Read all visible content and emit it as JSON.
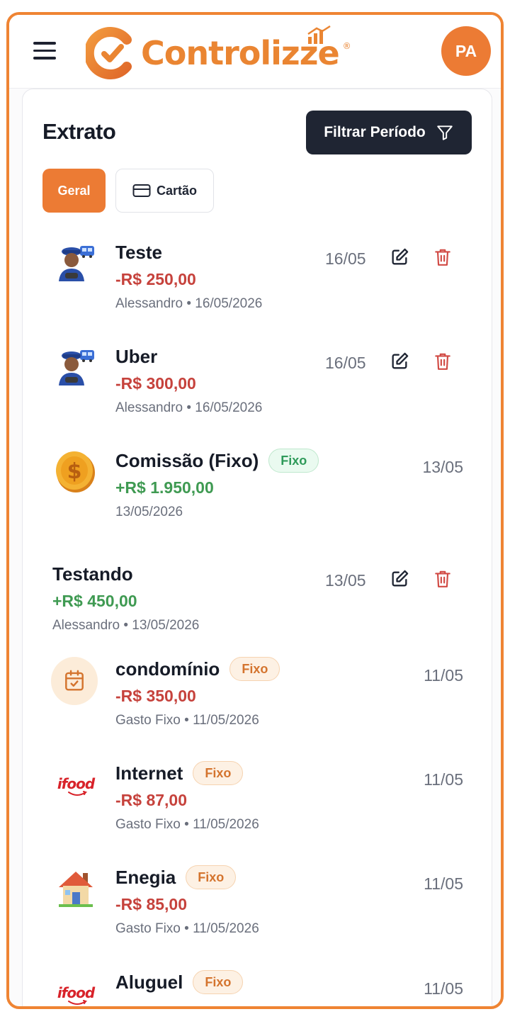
{
  "header": {
    "brand": "Controlizze",
    "registered": "®",
    "avatar_initials": "PA"
  },
  "extrato": {
    "title": "Extrato",
    "filter_label": "Filtrar Período",
    "tabs": [
      {
        "label": "Geral",
        "active": true
      },
      {
        "label": "Cartão",
        "active": false
      }
    ]
  },
  "transactions": [
    {
      "icon": "bus-driver-icon",
      "name": "Teste",
      "badge": "",
      "amount": "-R$ 250,00",
      "meta": "Alessandro • 16/05/2026",
      "date": "16/05",
      "editable": true
    },
    {
      "icon": "bus-driver-icon",
      "name": "Uber",
      "badge": "",
      "amount": "-R$ 300,00",
      "meta": "Alessandro • 16/05/2026",
      "date": "16/05",
      "editable": true
    },
    {
      "icon": "coin-dollar-icon",
      "name": "Comissão (Fixo)",
      "badge": "Fixo",
      "amount": "+R$ 1.950,00",
      "meta": "13/05/2026",
      "date": "13/05",
      "editable": false
    },
    {
      "icon": "",
      "name": "Testando",
      "badge": "",
      "amount": "+R$ 450,00",
      "meta": "Alessandro • 13/05/2026",
      "date": "13/05",
      "editable": true
    },
    {
      "icon": "calendar-check-icon",
      "name": "condomínio",
      "badge": "Fixo",
      "amount": "-R$ 350,00",
      "meta": "Gasto Fixo • 11/05/2026",
      "date": "11/05",
      "editable": false
    },
    {
      "icon": "ifood-logo-icon",
      "name": "Internet",
      "badge": "Fixo",
      "amount": "-R$ 87,00",
      "meta": "Gasto Fixo • 11/05/2026",
      "date": "11/05",
      "editable": false
    },
    {
      "icon": "house-icon",
      "name": "Enegia",
      "badge": "Fixo",
      "amount": "-R$ 85,00",
      "meta": "Gasto Fixo • 11/05/2026",
      "date": "11/05",
      "editable": false
    },
    {
      "icon": "ifood-logo-icon",
      "name": "Aluguel",
      "badge": "Fixo",
      "amount": "",
      "meta": "",
      "date": "11/05",
      "editable": false
    }
  ],
  "ifood_text": "ifood",
  "colors": {
    "brand_orange": "#ec7b34",
    "dark": "#1f2533",
    "negative": "#c6423c",
    "positive": "#3f9a52"
  }
}
